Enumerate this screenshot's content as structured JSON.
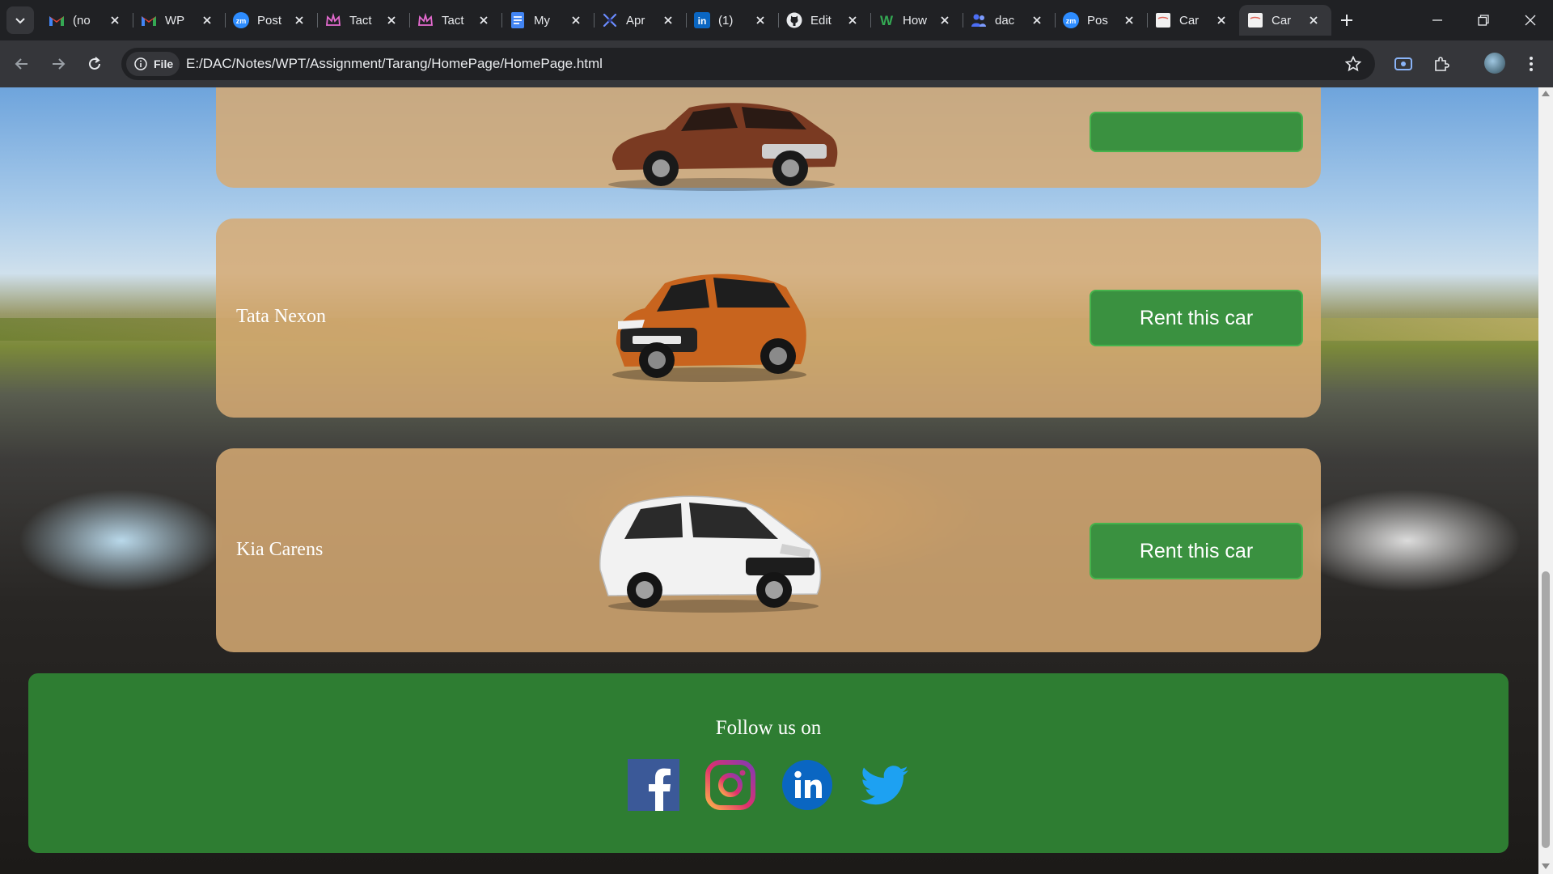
{
  "browser": {
    "tabs": [
      {
        "title": "(no",
        "icon": "gmail-icon"
      },
      {
        "title": "WP",
        "icon": "gmail-icon"
      },
      {
        "title": "Post",
        "icon": "zoom-icon"
      },
      {
        "title": "Tact",
        "icon": "crown-icon"
      },
      {
        "title": "Tact",
        "icon": "crown-icon"
      },
      {
        "title": "My",
        "icon": "docs-icon"
      },
      {
        "title": "Apr",
        "icon": "spark-icon"
      },
      {
        "title": "(1)",
        "icon": "linkedin-icon"
      },
      {
        "title": "Edit",
        "icon": "github-icon"
      },
      {
        "title": "How",
        "icon": "w-icon"
      },
      {
        "title": "dac",
        "icon": "people-icon"
      },
      {
        "title": "Pos",
        "icon": "zoom-icon"
      },
      {
        "title": "Car",
        "icon": "page-icon"
      },
      {
        "title": "Car",
        "icon": "page-icon",
        "active": true
      }
    ],
    "omnibox": {
      "chip_label": "File",
      "url": "E:/DAC/Notes/WPT/Assignment/Tarang/HomePage/HomePage.html"
    }
  },
  "page": {
    "cars": [
      {
        "name": "",
        "button_label": "",
        "body_color": "#7a3a22"
      },
      {
        "name": "Tata Nexon",
        "button_label": "Rent this car",
        "body_color": "#c8641e"
      },
      {
        "name": "Kia Carens",
        "button_label": "Rent this car",
        "body_color": "#f2f2f2"
      }
    ],
    "footer": {
      "heading": "Follow us on",
      "social": [
        "facebook-icon",
        "instagram-icon",
        "linkedin-icon",
        "twitter-icon"
      ]
    }
  },
  "colors": {
    "card_bg": "#d6aa73",
    "button_bg": "#3a9140",
    "footer_bg": "#2e7d32"
  }
}
